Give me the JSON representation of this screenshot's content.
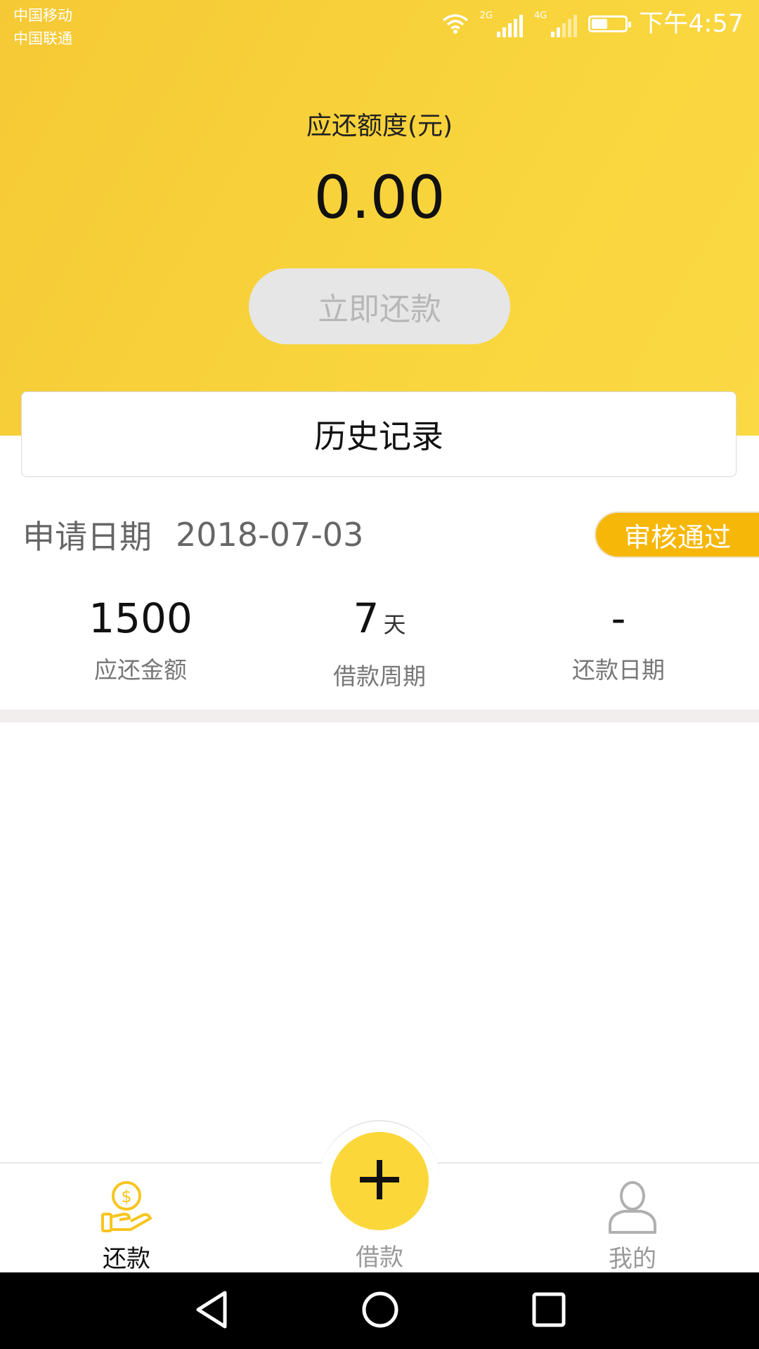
{
  "status_bar": {
    "carrier_1": "中国移动",
    "carrier_2": "中国联通",
    "network_1": "2G",
    "network_2": "4G",
    "time": "下午4:57"
  },
  "summary": {
    "due_label": "应还额度(元)",
    "due_amount": "0.00",
    "repay_button": "立即还款"
  },
  "history_button": "历史记录",
  "application": {
    "date_label": "申请日期",
    "date_value": "2018-07-03",
    "status_badge": "审核通过",
    "stats": [
      {
        "value": "1500",
        "unit": "",
        "label": "应还金额"
      },
      {
        "value": "7",
        "unit": "天",
        "label": "借款周期"
      },
      {
        "value": "-",
        "unit": "",
        "label": "还款日期"
      }
    ]
  },
  "tabbar": {
    "tabs": [
      {
        "label": "还款",
        "icon": "repay-hand-coin-icon",
        "active": true
      },
      {
        "label": "借款",
        "icon": "plus-icon",
        "active": false
      },
      {
        "label": "我的",
        "icon": "user-icon",
        "active": false
      }
    ]
  },
  "colors": {
    "brand_yellow": "#f9d53d",
    "badge_orange": "#f7b709",
    "button_disabled_bg": "#e6e6e6",
    "button_disabled_text": "#b7b7b7"
  }
}
